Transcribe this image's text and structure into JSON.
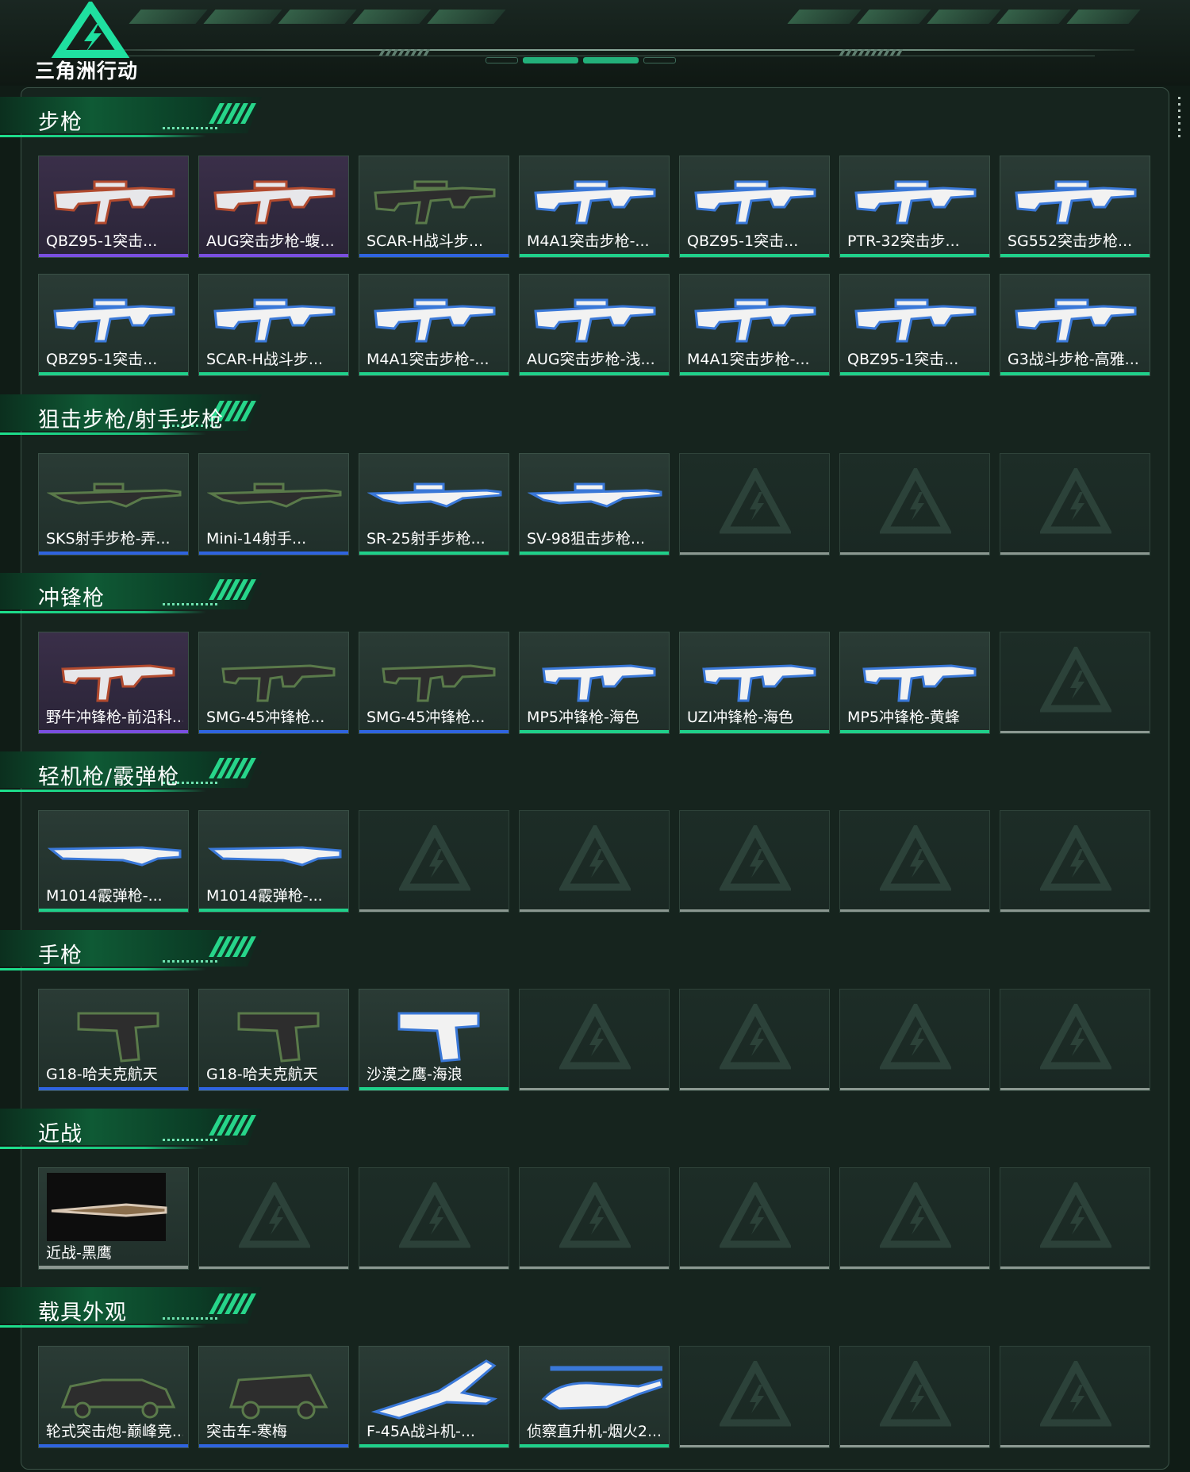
{
  "header": {
    "game_title": "三角洲行动",
    "logo_icon": "delta-force-logo-icon"
  },
  "colors": {
    "rarity_purple": "#7a4fe0",
    "rarity_blue": "#2f64e0",
    "rarity_green": "#1fd08a",
    "empty_slot": "#8b9891"
  },
  "sections": [
    {
      "title": "步枪",
      "items": [
        {
          "label": "QBZ95-1突击...",
          "rarity": "purple",
          "icon": "rifle-icon"
        },
        {
          "label": "AUG突击步枪-蝮...",
          "rarity": "purple",
          "icon": "rifle-icon"
        },
        {
          "label": "SCAR-H战斗步...",
          "rarity": "blue",
          "icon": "rifle-icon"
        },
        {
          "label": "M4A1突击步枪-...",
          "rarity": "green",
          "icon": "rifle-icon"
        },
        {
          "label": "QBZ95-1突击...",
          "rarity": "green",
          "icon": "rifle-icon"
        },
        {
          "label": "PTR-32突击步...",
          "rarity": "green",
          "icon": "rifle-icon"
        },
        {
          "label": "SG552突击步枪...",
          "rarity": "green",
          "icon": "rifle-icon"
        },
        {
          "label": "QBZ95-1突击...",
          "rarity": "green",
          "icon": "rifle-icon"
        },
        {
          "label": "SCAR-H战斗步...",
          "rarity": "green",
          "icon": "rifle-icon"
        },
        {
          "label": "M4A1突击步枪-...",
          "rarity": "green",
          "icon": "rifle-icon"
        },
        {
          "label": "AUG突击步枪-浅...",
          "rarity": "green",
          "icon": "rifle-icon"
        },
        {
          "label": "M4A1突击步枪-...",
          "rarity": "green",
          "icon": "rifle-icon"
        },
        {
          "label": "QBZ95-1突击...",
          "rarity": "green",
          "icon": "rifle-icon"
        },
        {
          "label": "G3战斗步枪-高雅...",
          "rarity": "green",
          "icon": "rifle-icon"
        }
      ]
    },
    {
      "title": "狙击步枪/射手步枪",
      "items": [
        {
          "label": "SKS射手步枪-弄...",
          "rarity": "blue",
          "icon": "sniper-icon"
        },
        {
          "label": "Mini-14射手...",
          "rarity": "blue",
          "icon": "sniper-icon"
        },
        {
          "label": "SR-25射手步枪...",
          "rarity": "green",
          "icon": "sniper-icon"
        },
        {
          "label": "SV-98狙击步枪...",
          "rarity": "green",
          "icon": "sniper-icon"
        },
        {
          "label": "",
          "rarity": "empty"
        },
        {
          "label": "",
          "rarity": "empty"
        },
        {
          "label": "",
          "rarity": "empty"
        }
      ]
    },
    {
      "title": "冲锋枪",
      "items": [
        {
          "label": "野牛冲锋枪-前沿科...",
          "rarity": "purple",
          "icon": "smg-icon"
        },
        {
          "label": "SMG-45冲锋枪...",
          "rarity": "blue",
          "icon": "smg-icon"
        },
        {
          "label": "SMG-45冲锋枪...",
          "rarity": "blue",
          "icon": "smg-icon"
        },
        {
          "label": "MP5冲锋枪-海色",
          "rarity": "green",
          "icon": "smg-icon"
        },
        {
          "label": "UZI冲锋枪-海色",
          "rarity": "green",
          "icon": "smg-icon"
        },
        {
          "label": "MP5冲锋枪-黄蜂",
          "rarity": "green",
          "icon": "smg-icon"
        },
        {
          "label": "",
          "rarity": "empty"
        }
      ]
    },
    {
      "title": "轻机枪/霰弹枪",
      "items": [
        {
          "label": "M1014霰弹枪-...",
          "rarity": "green",
          "icon": "shotgun-icon"
        },
        {
          "label": "M1014霰弹枪-...",
          "rarity": "green",
          "icon": "shotgun-icon"
        },
        {
          "label": "",
          "rarity": "empty"
        },
        {
          "label": "",
          "rarity": "empty"
        },
        {
          "label": "",
          "rarity": "empty"
        },
        {
          "label": "",
          "rarity": "empty"
        },
        {
          "label": "",
          "rarity": "empty"
        }
      ]
    },
    {
      "title": "手枪",
      "items": [
        {
          "label": "G18-哈夫克航天",
          "rarity": "blue",
          "icon": "pistol-icon"
        },
        {
          "label": "G18-哈夫克航天",
          "rarity": "blue",
          "icon": "pistol-icon"
        },
        {
          "label": "沙漠之鹰-海浪",
          "rarity": "green",
          "icon": "pistol-icon"
        },
        {
          "label": "",
          "rarity": "empty"
        },
        {
          "label": "",
          "rarity": "empty"
        },
        {
          "label": "",
          "rarity": "empty"
        },
        {
          "label": "",
          "rarity": "empty"
        }
      ]
    },
    {
      "title": "近战",
      "items": [
        {
          "label": "近战-黑鹰",
          "rarity": "gray",
          "icon": "knife-icon"
        },
        {
          "label": "",
          "rarity": "empty"
        },
        {
          "label": "",
          "rarity": "empty"
        },
        {
          "label": "",
          "rarity": "empty"
        },
        {
          "label": "",
          "rarity": "empty"
        },
        {
          "label": "",
          "rarity": "empty"
        },
        {
          "label": "",
          "rarity": "empty"
        }
      ]
    },
    {
      "title": "载具外观",
      "items": [
        {
          "label": "轮式突击炮-巅峰竞...",
          "rarity": "blue",
          "icon": "armored-car-icon"
        },
        {
          "label": "突击车-寒梅",
          "rarity": "blue",
          "icon": "assault-vehicle-icon"
        },
        {
          "label": "F-45A战斗机-...",
          "rarity": "green",
          "icon": "fighter-jet-icon"
        },
        {
          "label": "侦察直升机-烟火2...",
          "rarity": "green",
          "icon": "helicopter-icon"
        },
        {
          "label": "",
          "rarity": "empty"
        },
        {
          "label": "",
          "rarity": "empty"
        },
        {
          "label": "",
          "rarity": "empty"
        }
      ]
    }
  ]
}
